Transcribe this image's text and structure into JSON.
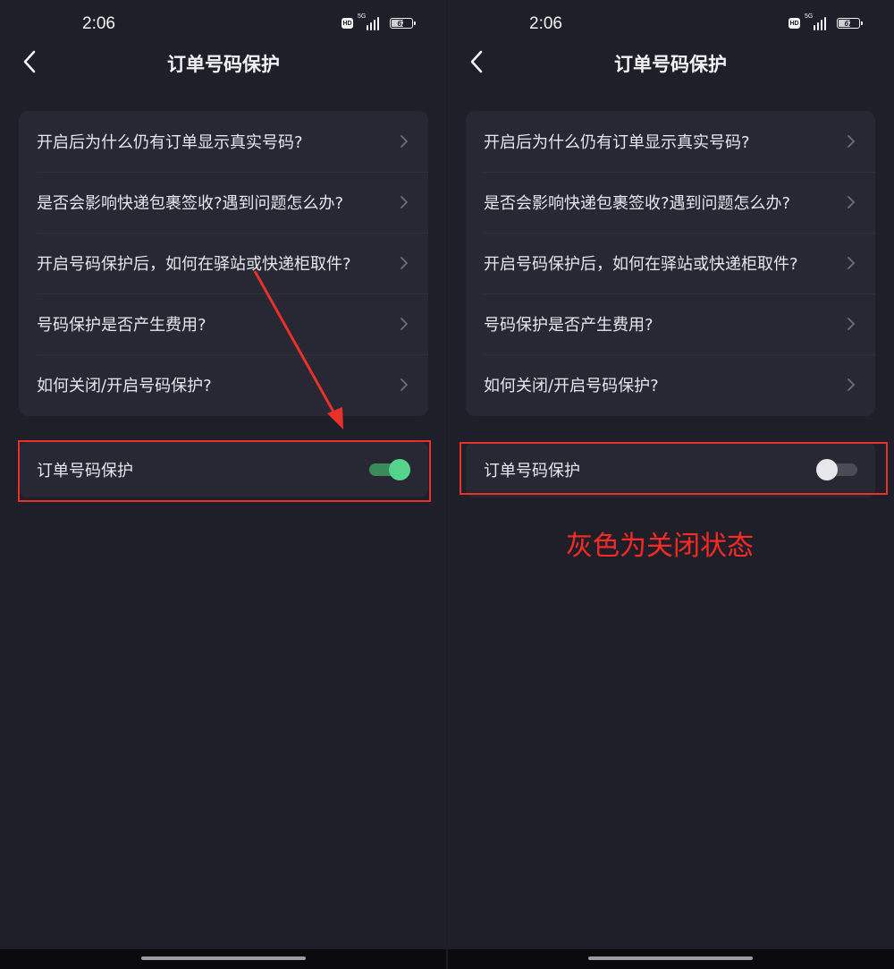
{
  "status_bar": {
    "time": "2:06",
    "hd_badge": "HD",
    "network": "5G",
    "battery_level": "67"
  },
  "nav": {
    "title": "订单号码保护"
  },
  "faq": [
    {
      "label": "开启后为什么仍有订单显示真实号码?"
    },
    {
      "label": "是否会影响快递包裹签收?遇到问题怎么办?"
    },
    {
      "label": "开启号码保护后，如何在驿站或快递柜取件?"
    },
    {
      "label": "号码保护是否产生费用?"
    },
    {
      "label": "如何关闭/开启号码保护?"
    }
  ],
  "left_panel": {
    "toggle_label": "订单号码保护",
    "toggle_on": true
  },
  "right_panel": {
    "toggle_label": "订单号码保护",
    "toggle_on": false
  },
  "annotation": {
    "text": "灰色为关闭状态"
  },
  "colors": {
    "background": "#1e1f28",
    "card": "#272833",
    "toggle_on": "#55d38b",
    "toggle_off": "#e8e8ec",
    "annotation_red": "#e8312a"
  },
  "icons": {
    "back": "chevron-left-icon",
    "row_arrow": "chevron-right-icon"
  }
}
